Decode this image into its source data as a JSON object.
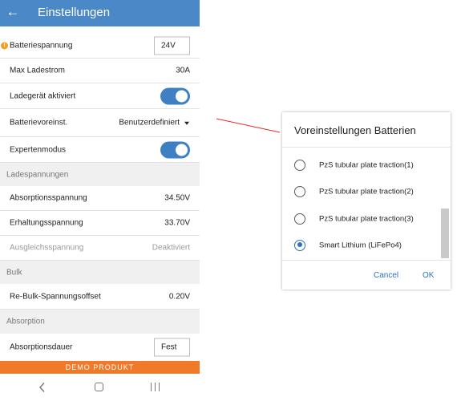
{
  "appbar": {
    "title": "Einstellungen",
    "back_icon": "arrow-left-icon"
  },
  "colors": {
    "primary": "#4a88c8",
    "toggle_on": "#3f7fc4",
    "demo_banner": "#f07a2a",
    "warning": "#f0a020",
    "connector": "#e03030",
    "dialog_accent": "#2e71c0"
  },
  "settings": {
    "battery_voltage": {
      "label": "Batteriespannung",
      "value": "24V",
      "warning_icon": "warning-icon"
    },
    "max_charge_current": {
      "label": "Max Ladestrom",
      "value": "30A"
    },
    "charger_enabled": {
      "label": "Ladegerät aktiviert",
      "on": true
    },
    "battery_preset": {
      "label": "Batterievoreinst.",
      "value": "Benutzerdefiniert"
    },
    "expert_mode": {
      "label": "Expertenmodus",
      "on": true
    }
  },
  "charge_voltages": {
    "header": "Ladespannungen",
    "absorption": {
      "label": "Absorptionsspannung",
      "value": "34.50V"
    },
    "float": {
      "label": "Erhaltungsspannung",
      "value": "33.70V"
    },
    "equalization": {
      "label": "Ausgleichsspannung",
      "value": "Deaktiviert"
    }
  },
  "bulk": {
    "header": "Bulk",
    "rebulk_offset": {
      "label": "Re-Bulk-Spannungsoffset",
      "value": "0.20V"
    }
  },
  "absorption": {
    "header": "Absorption",
    "duration": {
      "label": "Absorptionsdauer",
      "value": "Fest"
    }
  },
  "demo_banner": "DEMO PRODUKT",
  "dialog": {
    "title": "Voreinstellungen Batterien",
    "options": [
      {
        "label": "PzS tubular plate traction(1)",
        "selected": false
      },
      {
        "label": "PzS tubular plate traction(2)",
        "selected": false
      },
      {
        "label": "PzS tubular plate traction(3)",
        "selected": false
      },
      {
        "label": "Smart Lithium (LiFePo4)",
        "selected": true
      }
    ],
    "cancel": "Cancel",
    "ok": "OK"
  }
}
